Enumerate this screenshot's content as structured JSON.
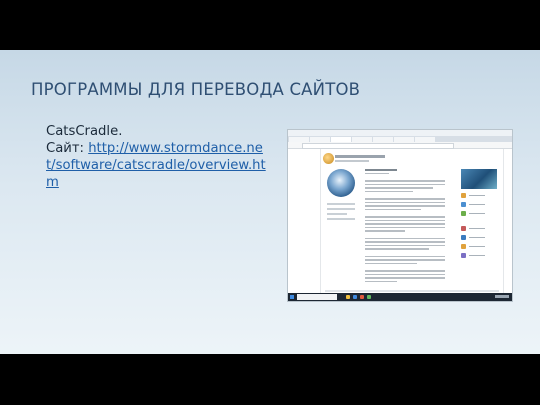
{
  "slide": {
    "title": "ПРОГРАММЫ ДЛЯ ПЕРЕВОДА САЙТОВ",
    "product_name": "CatsCradle",
    "product_suffix": ".",
    "site_label": "Сайт: ",
    "site_url": "http://www.stormdance.net/software/catscradle/overview.htm"
  },
  "screenshot": {
    "description_icons": [
      "browser-window",
      "cats-cradle-logo",
      "taskbar"
    ]
  },
  "colors": {
    "title": "#2f4f73",
    "link": "#1f5fa8",
    "background_top": "#c6d8e6",
    "background_bottom": "#edf4f8"
  }
}
